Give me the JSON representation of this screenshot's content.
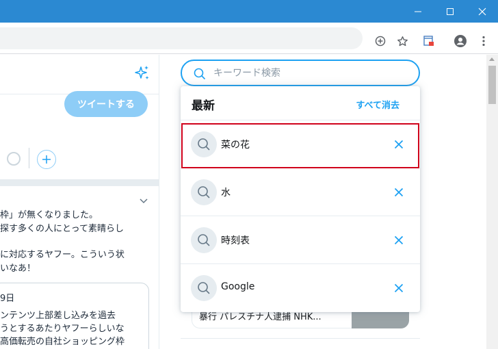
{
  "colors": {
    "titlebar": "#2b89d2",
    "accent": "#1da1f2",
    "highlight": "#d0021b",
    "tweet_button_disabled": "#8ecdf7"
  },
  "window": {
    "minimize_icon": "minimize-icon",
    "maximize_icon": "maximize-icon",
    "close_icon": "close-icon"
  },
  "toolbar": {
    "icons": [
      "add-circle-icon",
      "star-icon",
      "extension-icon",
      "account-icon",
      "more-vert-icon"
    ]
  },
  "left": {
    "compose_button": "ツイートする",
    "tweet_lines": [
      "枠」が無くなりました。",
      "探す多くの人にとって素晴らし",
      "に対応するヤフー。こういう状",
      "いなあ！"
    ],
    "quoted_lines": [
      "9日",
      "ンテンツ上部差し込みを過去",
      "うとするあたりヤフーらしいな",
      "高価転売の自社ショッピング枠"
    ]
  },
  "search": {
    "placeholder": "キーワード検索",
    "value": "",
    "dropdown": {
      "title": "最新",
      "clear_all": "すべて消去",
      "items": [
        {
          "label": "菜の花"
        },
        {
          "label": "水"
        },
        {
          "label": "時刻表"
        },
        {
          "label": "Google"
        }
      ]
    }
  },
  "background_card": {
    "text": "暴行 パレスチナ人逮捕 NHK..."
  }
}
